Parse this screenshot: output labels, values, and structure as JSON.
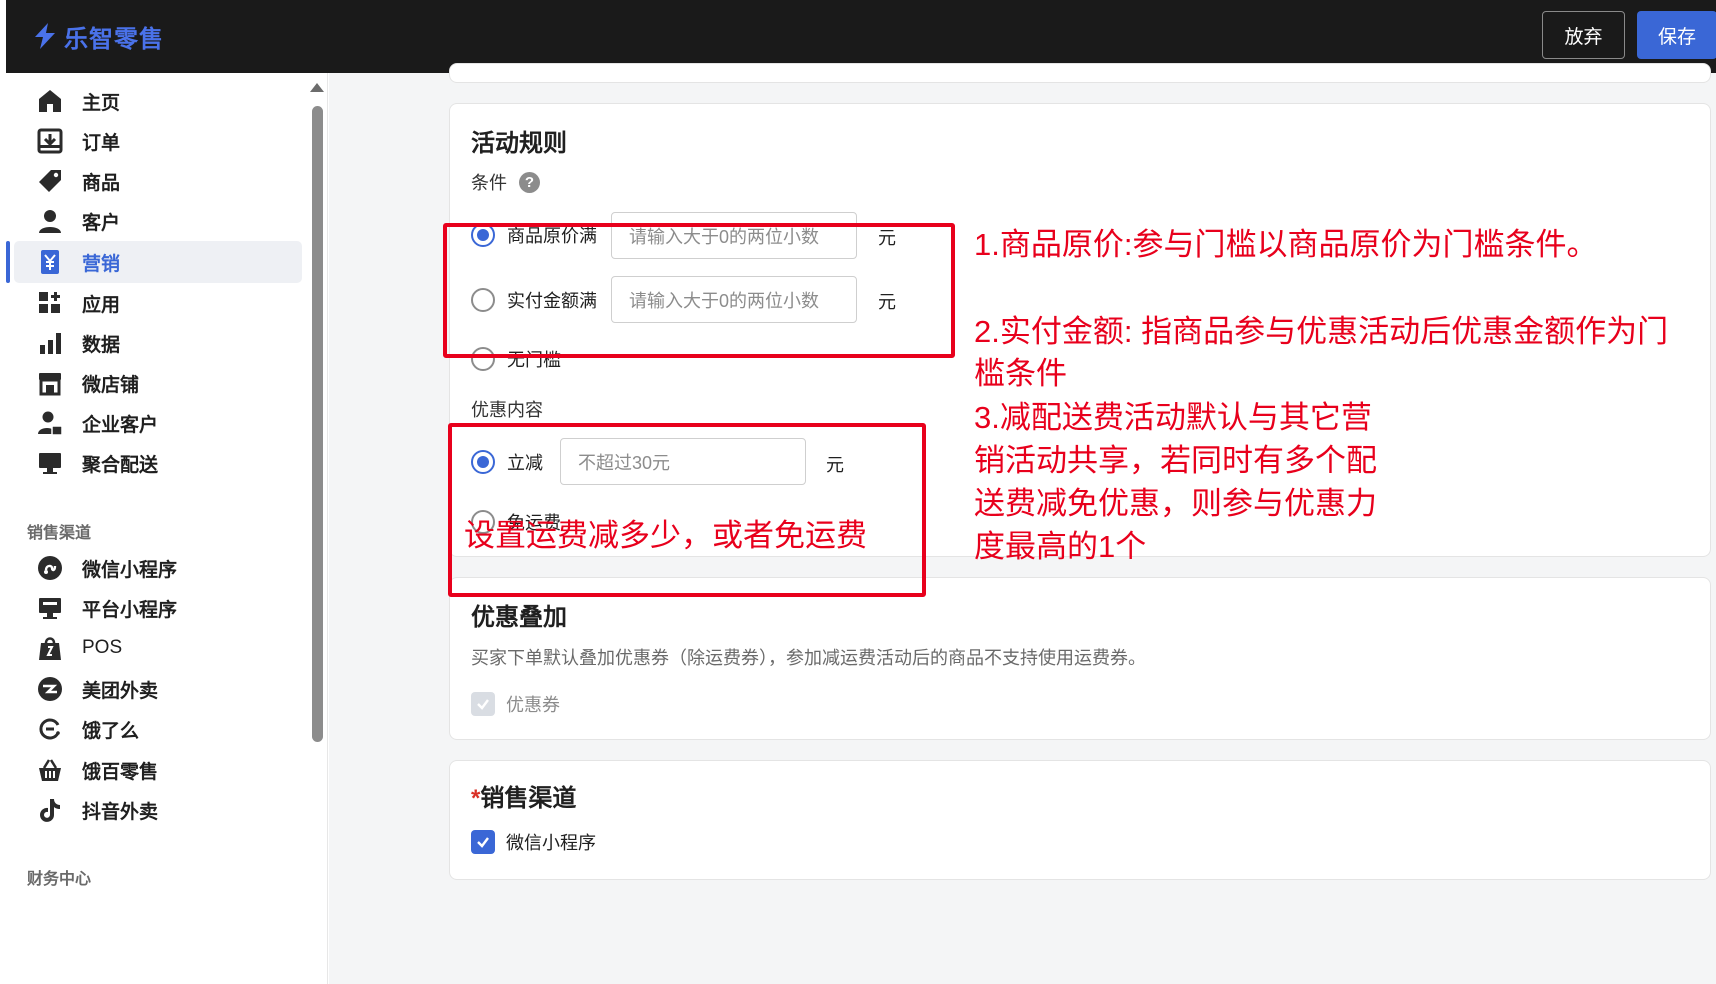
{
  "app": {
    "brand": "乐智零售"
  },
  "topbar": {
    "abandon_label": "放弃",
    "save_label": "保存"
  },
  "sidebar": {
    "items": [
      {
        "label": "主页",
        "icon": "home-icon"
      },
      {
        "label": "订单",
        "icon": "order-icon"
      },
      {
        "label": "商品",
        "icon": "tag-icon"
      },
      {
        "label": "客户",
        "icon": "user-icon"
      },
      {
        "label": "营销",
        "icon": "yen-icon",
        "active": true
      },
      {
        "label": "应用",
        "icon": "apps-icon"
      },
      {
        "label": "数据",
        "icon": "bar-chart-icon"
      },
      {
        "label": "微店铺",
        "icon": "store-icon"
      },
      {
        "label": "企业客户",
        "icon": "enterprise-user-icon"
      },
      {
        "label": "聚合配送",
        "icon": "monitor-icon"
      }
    ],
    "channels_title": "销售渠道",
    "channels": [
      {
        "label": "微信小程序",
        "icon": "mini-program-icon"
      },
      {
        "label": "平台小程序",
        "icon": "platform-icon"
      },
      {
        "label": "POS",
        "icon": "pos-icon"
      },
      {
        "label": "美团外卖",
        "icon": "meituan-icon"
      },
      {
        "label": "饿了么",
        "icon": "eleme-icon"
      },
      {
        "label": "饿百零售",
        "icon": "basket-icon"
      },
      {
        "label": "抖音外卖",
        "icon": "douyin-icon"
      }
    ],
    "finance_title": "财务中心"
  },
  "rules": {
    "title": "活动规则",
    "condition_label": "条件",
    "options": [
      {
        "label": "商品原价满",
        "placeholder": "请输入大于0的两位小数",
        "unit": "元",
        "checked": true
      },
      {
        "label": "实付金额满",
        "placeholder": "请输入大于0的两位小数",
        "unit": "元",
        "checked": false
      },
      {
        "label": "无门槛",
        "checked": false
      }
    ],
    "discount_label": "优惠内容",
    "discount_options": [
      {
        "label": "立减",
        "placeholder": "不超过30元",
        "unit": "元",
        "checked": true
      },
      {
        "label": "免运费",
        "checked": false
      }
    ]
  },
  "annotations": {
    "note1": "1.商品原价:参与门槛以商品原价为门槛条件。",
    "note2_line1": "2.实付金额: 指商品参与优惠活动后优惠金额作为门",
    "note2_line2": "槛条件",
    "note3_line1": "3.减配送费活动默认与其它营",
    "note3_line2": "销活动共享，若同时有多个配",
    "note3_line3": "送费减免优惠，则参与优惠力",
    "note3_line4": "度最高的1个",
    "overlay_text": "设置运费减多少，或者免运费",
    "color": "#e8001c"
  },
  "stacking": {
    "title": "优惠叠加",
    "description": "买家下单默认叠加优惠券（除运费券），参加减运费活动后的商品不支持使用运费券。",
    "coupon_label": "优惠券"
  },
  "channel_section": {
    "required_mark": "*",
    "title": "销售渠道",
    "option_label": "微信小程序"
  },
  "colors": {
    "accent": "#3a67d6",
    "topbar": "#1a1a1a",
    "annotation": "#e8001c"
  }
}
